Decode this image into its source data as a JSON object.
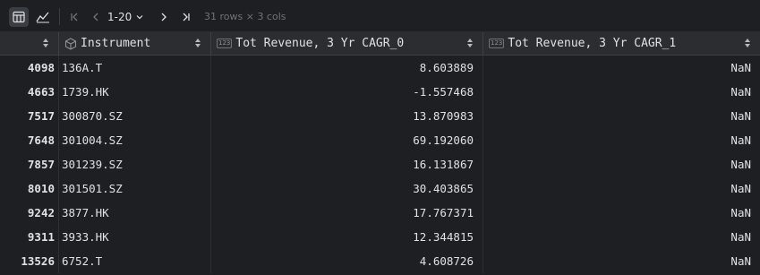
{
  "toolbar": {
    "page_range": "1-20",
    "row_info": "31 rows × 3 cols"
  },
  "columns": [
    {
      "label": ""
    },
    {
      "label": "Instrument",
      "icon": "cube-icon"
    },
    {
      "label": "Tot Revenue, 3 Yr CAGR_0",
      "icon": "numeric-type-icon"
    },
    {
      "label": "Tot Revenue, 3 Yr CAGR_1",
      "icon": "numeric-type-icon"
    }
  ],
  "numeric_type_badge": "123",
  "rows": [
    {
      "idx": "4098",
      "instrument": "136A.T",
      "cagr0": "8.603889",
      "cagr1": "NaN"
    },
    {
      "idx": "4663",
      "instrument": "1739.HK",
      "cagr0": "-1.557468",
      "cagr1": "NaN"
    },
    {
      "idx": "7517",
      "instrument": "300870.SZ",
      "cagr0": "13.870983",
      "cagr1": "NaN"
    },
    {
      "idx": "7648",
      "instrument": "301004.SZ",
      "cagr0": "69.192060",
      "cagr1": "NaN"
    },
    {
      "idx": "7857",
      "instrument": "301239.SZ",
      "cagr0": "16.131867",
      "cagr1": "NaN"
    },
    {
      "idx": "8010",
      "instrument": "301501.SZ",
      "cagr0": "30.403865",
      "cagr1": "NaN"
    },
    {
      "idx": "9242",
      "instrument": "3877.HK",
      "cagr0": "17.767371",
      "cagr1": "NaN"
    },
    {
      "idx": "9311",
      "instrument": "3933.HK",
      "cagr0": "12.344815",
      "cagr1": "NaN"
    },
    {
      "idx": "13526",
      "instrument": "6752.T",
      "cagr0": "4.608726",
      "cagr1": "NaN"
    }
  ]
}
